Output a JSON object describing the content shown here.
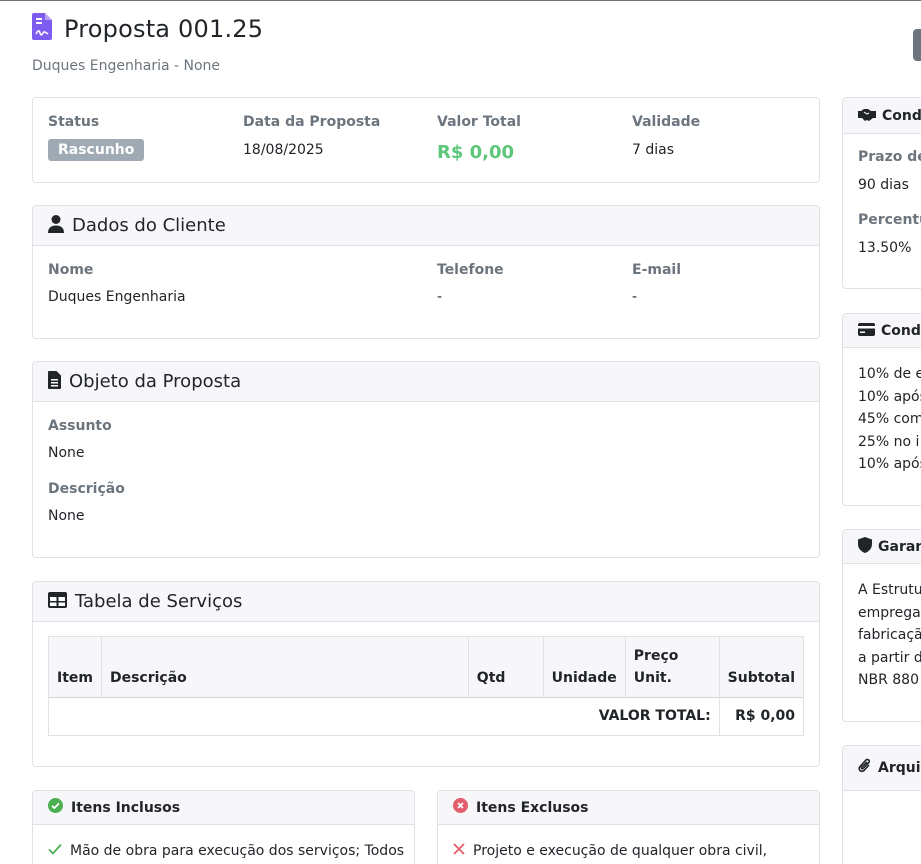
{
  "header": {
    "title": "Proposta 001.25",
    "subtitle": "Duques Engenharia - None"
  },
  "summary": {
    "status_label": "Status",
    "status_badge": "Rascunho",
    "date_label": "Data da Proposta",
    "date_value": "18/08/2025",
    "total_label": "Valor Total",
    "total_value": "R$ 0,00",
    "validity_label": "Validade",
    "validity_value": "7 dias"
  },
  "client": {
    "title": "Dados do Cliente",
    "name_label": "Nome",
    "name_value": "Duques Engenharia",
    "phone_label": "Telefone",
    "phone_value": "-",
    "email_label": "E-mail",
    "email_value": "-"
  },
  "object": {
    "title": "Objeto da Proposta",
    "subject_label": "Assunto",
    "subject_value": "None",
    "description_label": "Descrição",
    "description_value": "None"
  },
  "services": {
    "title": "Tabela de Serviços",
    "columns": [
      "Item",
      "Descrição",
      "Qtd",
      "Unidade",
      "Preço Unit.",
      "Subtotal"
    ],
    "total_label": "VALOR TOTAL:",
    "total_value": "R$ 0,00"
  },
  "included": {
    "title": "Itens Inclusos",
    "items": [
      "Mão de obra para execução dos serviços; Todos"
    ]
  },
  "excluded": {
    "title": "Itens Exclusos",
    "items": [
      "Projeto e execução de qualquer obra civil,"
    ]
  },
  "sidebar": {
    "conditions": {
      "title": "Cond",
      "prazo_label": "Prazo de",
      "prazo_value": "90 dias",
      "percent_label": "Percentu",
      "percent_value": "13.50%"
    },
    "payment": {
      "title": "Condi",
      "lines": [
        "10% de e",
        "10% após",
        "45% com",
        "25% no i",
        "10% após"
      ]
    },
    "guarantee": {
      "title": "Garan",
      "lines": [
        "A Estrutu",
        "empregad",
        "fabricaçã",
        "a partir d",
        "NBR 880"
      ]
    },
    "files": {
      "title": "Arquiv"
    }
  },
  "colors": {
    "accent_purple": "#7d5cf0",
    "money_green": "#5cc77a",
    "badge_gray": "#a0aab4",
    "check_green": "#4caf50",
    "cross_red": "#e35d6a"
  }
}
